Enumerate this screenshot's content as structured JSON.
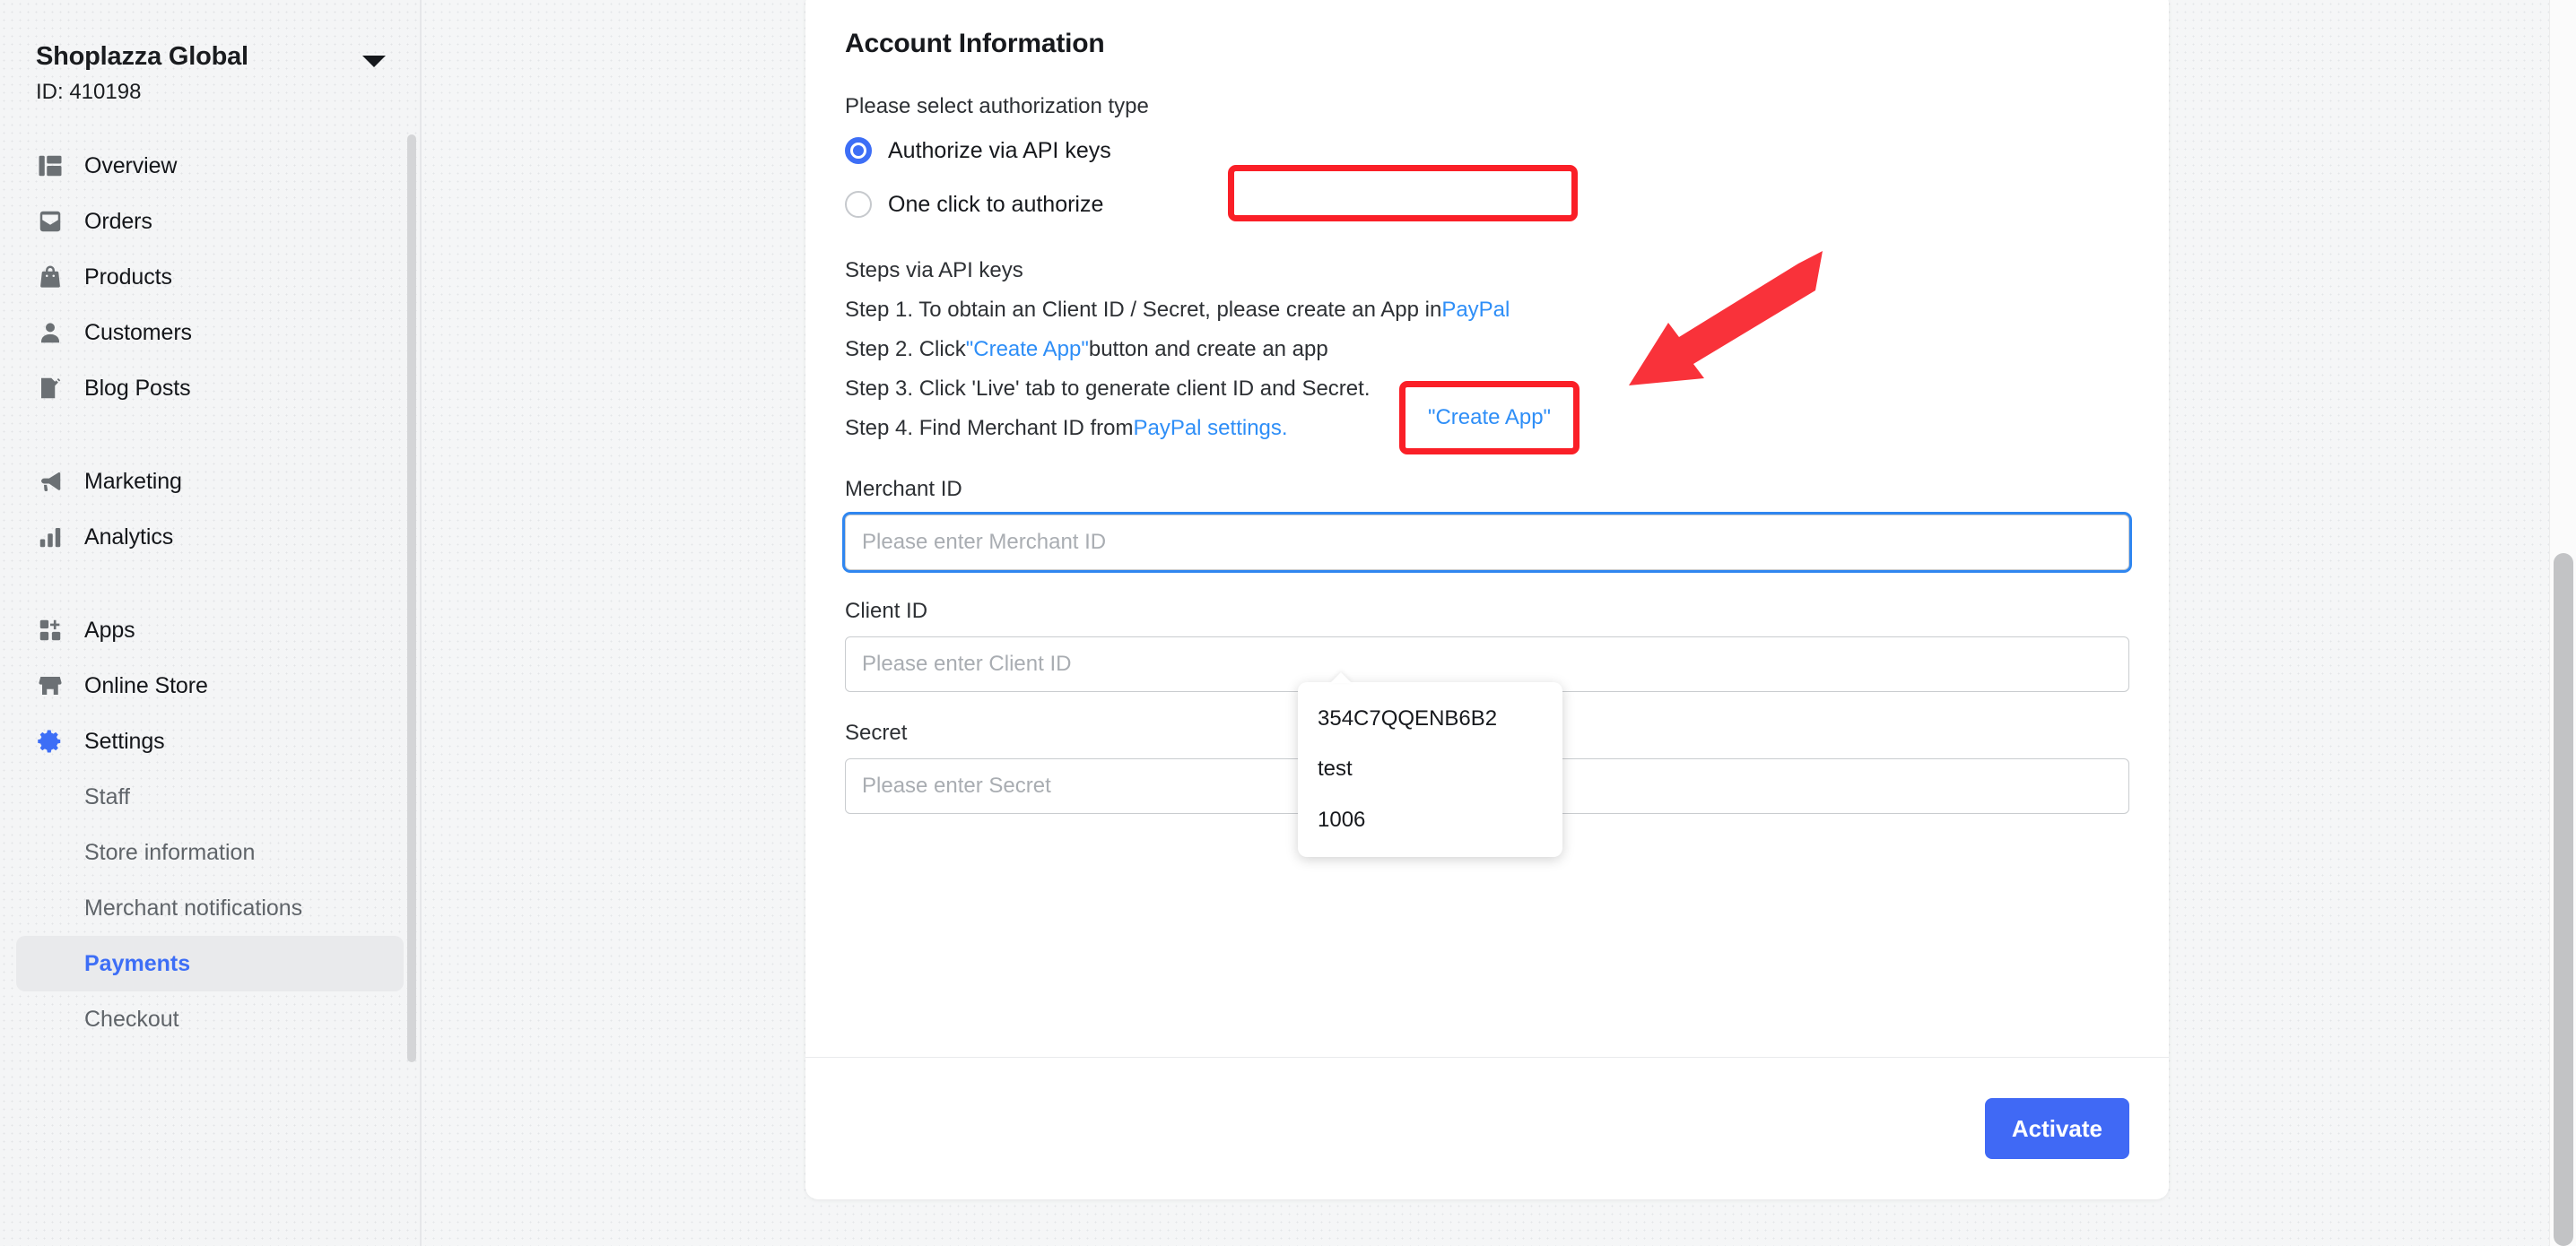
{
  "sidebar": {
    "store_name": "Shoplazza Global",
    "store_id": "ID: 410198",
    "nav_primary": [
      {
        "label": "Overview",
        "icon": "dashboard-icon"
      },
      {
        "label": "Orders",
        "icon": "inbox-icon"
      },
      {
        "label": "Products",
        "icon": "bag-icon"
      },
      {
        "label": "Customers",
        "icon": "person-icon"
      },
      {
        "label": "Blog Posts",
        "icon": "blog-pencil-icon"
      }
    ],
    "nav_secondary": [
      {
        "label": "Marketing",
        "icon": "megaphone-icon"
      },
      {
        "label": "Analytics",
        "icon": "bar-chart-icon"
      }
    ],
    "nav_tertiary": [
      {
        "label": "Apps",
        "icon": "apps-grid-icon"
      },
      {
        "label": "Online Store",
        "icon": "storefront-icon"
      },
      {
        "label": "Settings",
        "icon": "gear-icon"
      }
    ],
    "settings_children": [
      {
        "label": "Staff",
        "active": false
      },
      {
        "label": "Store information",
        "active": false
      },
      {
        "label": "Merchant notifications",
        "active": false
      },
      {
        "label": "Payments",
        "active": true
      },
      {
        "label": "Checkout",
        "active": false
      }
    ]
  },
  "card": {
    "title": "Account Information",
    "auth_prompt": "Please select authorization type",
    "radio_options": [
      {
        "label": "Authorize via API keys",
        "selected": true
      },
      {
        "label": "One click to authorize",
        "selected": false
      }
    ],
    "steps_heading": "Steps via API keys",
    "steps": [
      {
        "prefix": "Step 1. To obtain an Client ID / Secret, please create an App in ",
        "link": "PayPal",
        "suffix": ""
      },
      {
        "prefix": "Step 2. Click ",
        "link": "\"Create App\"",
        "suffix": " button and create an app"
      },
      {
        "prefix": "Step 3. Click 'Live' tab to generate client ID and Secret.",
        "link": "",
        "suffix": ""
      },
      {
        "prefix": "Step 4. Find Merchant ID from ",
        "link": "PayPal settings.",
        "suffix": ""
      }
    ],
    "fields": [
      {
        "label": "Merchant ID",
        "value": "",
        "placeholder": "Please enter Merchant ID",
        "focused": true
      },
      {
        "label": "Client ID",
        "value": "",
        "placeholder": "Please enter Client ID",
        "focused": false
      },
      {
        "label": "Secret",
        "value": "",
        "placeholder": "Please enter Secret",
        "focused": false
      }
    ],
    "suggestions": [
      "354C7QQENB6B2",
      "test",
      "1006"
    ],
    "activate_label": "Activate"
  },
  "annotations": {
    "create_app_text": "\"Create App\"",
    "highlight_color": "#fa1f27",
    "arrow_color": "#f9323a"
  },
  "colors": {
    "accent_blue": "#3d6ef6",
    "button_blue": "#4069f5",
    "link_blue": "#2e8ef7",
    "annotation_red": "#fa1f27"
  }
}
